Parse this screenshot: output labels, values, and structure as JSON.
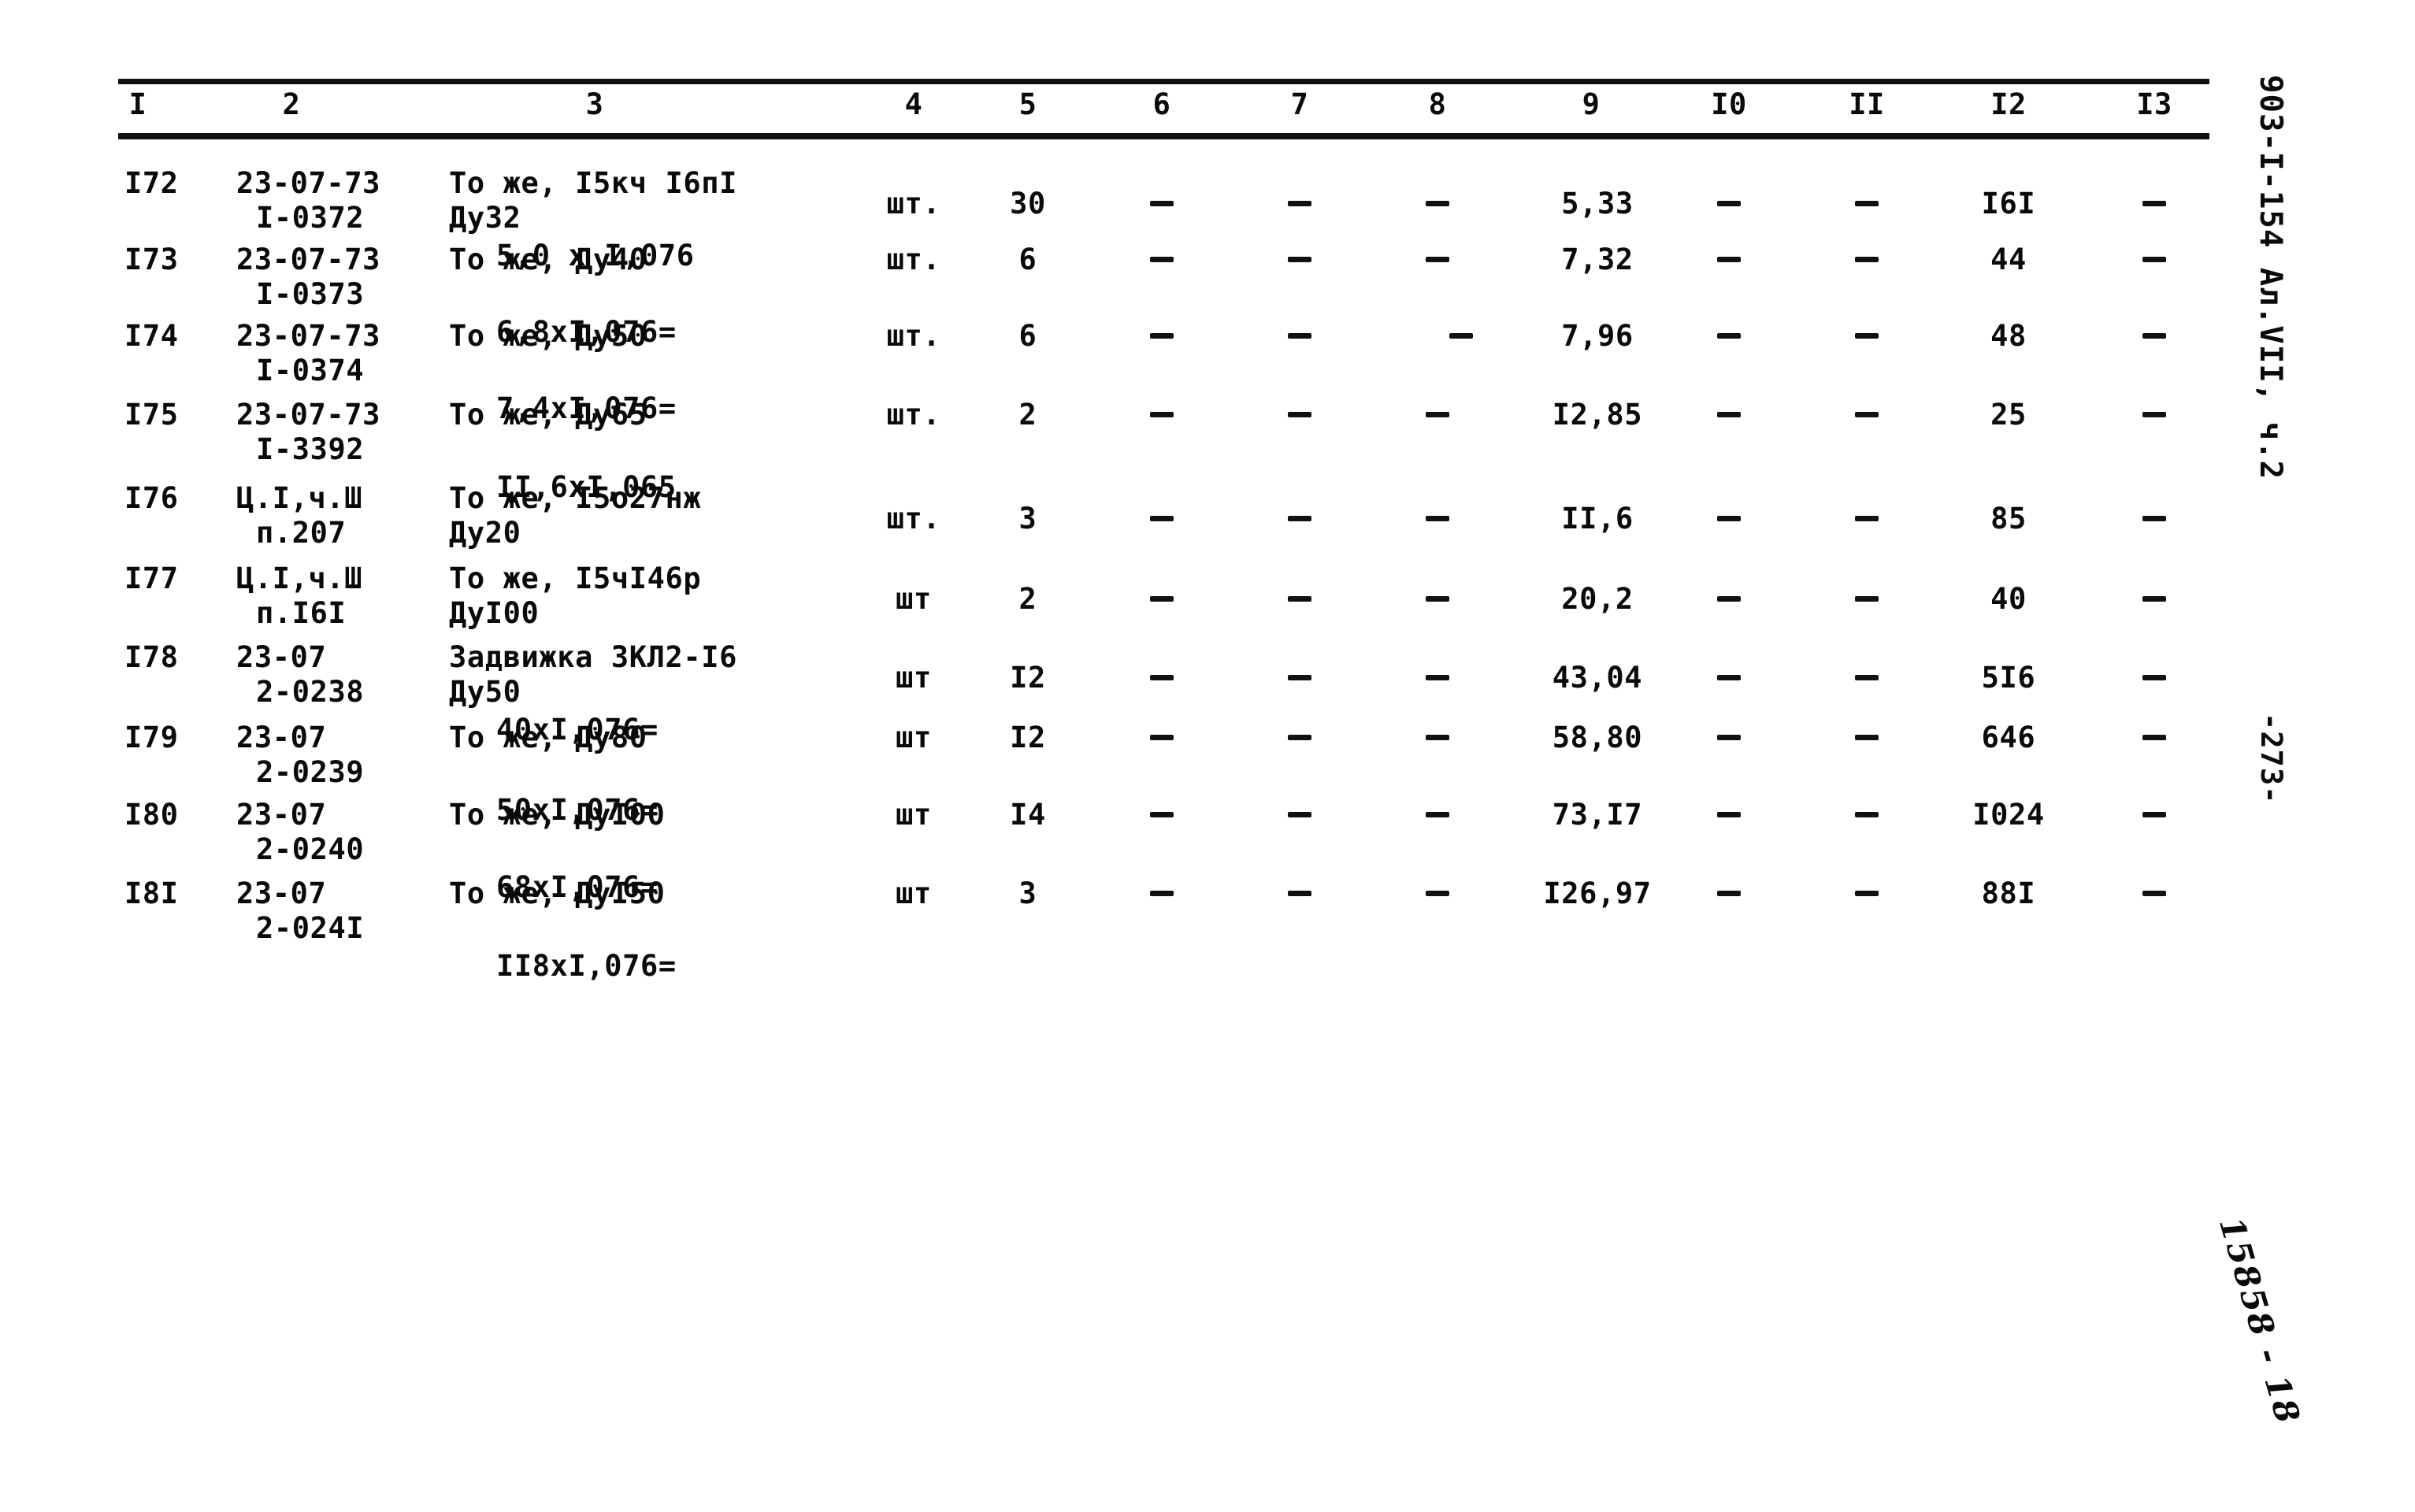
{
  "document": {
    "margin_id": "903-I-154  Ал.VII, ч.2",
    "page_number": "-273-",
    "stamp": "15858 - 18"
  },
  "table": {
    "column_headers": [
      "I",
      "2",
      "3",
      "4",
      "5",
      "6",
      "7",
      "8",
      "9",
      "I0",
      "II",
      "I2",
      "I3"
    ],
    "rows": [
      {
        "n": "I72",
        "code_l1": "23-07-73",
        "code_l2": "I-0372",
        "desc_l1": "То же, I5кч I6пI",
        "desc_l2": "Ду32",
        "desc_l3": "5,0 х I,076",
        "unit": "шт.",
        "qty": "30",
        "c6": "-",
        "c7": "-",
        "c8": "-",
        "c9": "5,33",
        "c10": "-",
        "c11": "-",
        "c12": "I6I",
        "c13": "-"
      },
      {
        "n": "I73",
        "code_l1": "23-07-73",
        "code_l2": "I-0373",
        "desc_l1": "То же, Ду40",
        "desc_l2": "",
        "desc_l3": "6,8хI,076=",
        "unit": "шт.",
        "qty": "6",
        "c6": "-",
        "c7": "-",
        "c8": "-",
        "c9": "7,32",
        "c10": "-",
        "c11": "-",
        "c12": "44",
        "c13": "-"
      },
      {
        "n": "I74",
        "code_l1": "23-07-73",
        "code_l2": "I-0374",
        "desc_l1": "То же, Ду50",
        "desc_l2": "",
        "desc_l3": "7,4хI,076=",
        "unit": "шт.",
        "qty": "6",
        "c6": "-",
        "c7": "-",
        "c8": "-",
        "c9": "7,96",
        "c10": "-",
        "c11": "-",
        "c12": "48",
        "c13": "-"
      },
      {
        "n": "I75",
        "code_l1": "23-07-73",
        "code_l2": "I-3392",
        "desc_l1": "То же, Ду65",
        "desc_l2": "",
        "desc_l3": "II,6хI,065",
        "unit": "шт.",
        "qty": "2",
        "c6": "-",
        "c7": "-",
        "c8": "-",
        "c9": "I2,85",
        "c10": "-",
        "c11": "-",
        "c12": "25",
        "c13": "-"
      },
      {
        "n": "I76",
        "code_l1": "Ц.I,ч.Ш",
        "code_l2": "п.207",
        "desc_l1": "То же, I5о27нж",
        "desc_l2": "Ду20",
        "desc_l3": "",
        "unit": "шт.",
        "qty": "3",
        "c6": "-",
        "c7": "-",
        "c8": "-",
        "c9": "II,6",
        "c10": "-",
        "c11": "-",
        "c12": "85",
        "c13": "-"
      },
      {
        "n": "I77",
        "code_l1": "Ц.I,ч.Ш",
        "code_l2": "п.I6I",
        "desc_l1": "То же, I5чI46р",
        "desc_l2": "ДуI00",
        "desc_l3": "",
        "unit": "шт",
        "qty": "2",
        "c6": "-",
        "c7": "-",
        "c8": "-",
        "c9": "20,2",
        "c10": "-",
        "c11": "-",
        "c12": "40",
        "c13": "-"
      },
      {
        "n": "I78",
        "code_l1": "23-07",
        "code_l2": "2-0238",
        "desc_l1": "Задвижка ЗКЛ2-I6",
        "desc_l2": "Ду50",
        "desc_l3": "40хI,076=",
        "unit": "шт",
        "qty": "I2",
        "c6": "-",
        "c7": "-",
        "c8": "-",
        "c9": "43,04",
        "c10": "-",
        "c11": "-",
        "c12": "5I6",
        "c13": "-"
      },
      {
        "n": "I79",
        "code_l1": "23-07",
        "code_l2": "2-0239",
        "desc_l1": "То же, Ду80",
        "desc_l2": "",
        "desc_l3": "50хI,076=",
        "unit": "шт",
        "qty": "I2",
        "c6": "-",
        "c7": "-",
        "c8": "-",
        "c9": "58,80",
        "c10": "-",
        "c11": "-",
        "c12": "646",
        "c13": "-"
      },
      {
        "n": "I80",
        "code_l1": "23-07",
        "code_l2": "2-0240",
        "desc_l1": "То же, ДуI00",
        "desc_l2": "",
        "desc_l3": "68хI,076=",
        "unit": "шт",
        "qty": "I4",
        "c6": "-",
        "c7": "-",
        "c8": "-",
        "c9": "73,I7",
        "c10": "-",
        "c11": "-",
        "c12": "I024",
        "c13": "-"
      },
      {
        "n": "I8I",
        "code_l1": "23-07",
        "code_l2": "2-024I",
        "desc_l1": "То же, ДуI50",
        "desc_l2": "",
        "desc_l3": "II8хI,076=",
        "unit": "шт",
        "qty": "3",
        "c6": "-",
        "c7": "-",
        "c8": "-",
        "c9": "I26,97",
        "c10": "-",
        "c11": "-",
        "c12": "88I",
        "c13": "-"
      }
    ]
  }
}
